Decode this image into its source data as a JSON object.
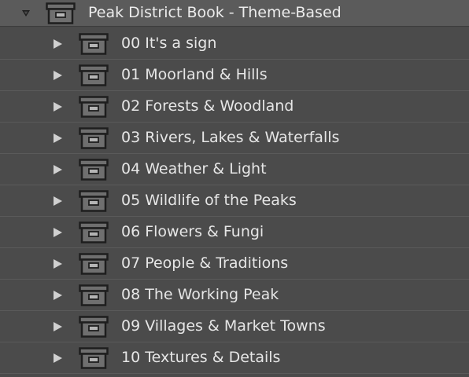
{
  "collection_set": {
    "name": "Peak District Book - Theme-Based",
    "expanded": true,
    "icon": "collection-set-icon",
    "children": [
      {
        "name": "00 It's a sign",
        "icon": "collection-set-icon",
        "expanded": false
      },
      {
        "name": "01 Moorland & Hills",
        "icon": "collection-set-icon",
        "expanded": false
      },
      {
        "name": "02 Forests & Woodland",
        "icon": "collection-set-icon",
        "expanded": false
      },
      {
        "name": "03 Rivers, Lakes & Waterfalls",
        "icon": "collection-set-icon",
        "expanded": false
      },
      {
        "name": "04 Weather & Light",
        "icon": "collection-set-icon",
        "expanded": false
      },
      {
        "name": "05 Wildlife of the Peaks",
        "icon": "collection-set-icon",
        "expanded": false
      },
      {
        "name": "06 Flowers & Fungi",
        "icon": "collection-set-icon",
        "expanded": false
      },
      {
        "name": "07 People & Traditions",
        "icon": "collection-set-icon",
        "expanded": false
      },
      {
        "name": "08 The Working Peak",
        "icon": "collection-set-icon",
        "expanded": false
      },
      {
        "name": "09 Villages & Market Towns",
        "icon": "collection-set-icon",
        "expanded": false
      },
      {
        "name": "10 Textures & Details",
        "icon": "collection-set-icon",
        "expanded": false
      }
    ]
  },
  "colors": {
    "panel_background": "#4a4a4a",
    "parent_row_background": "#5b5b5b",
    "row_separator": "#5a5a5a",
    "text": "#e6e6e6",
    "icon_stroke": "#1e1e1e",
    "icon_fill": "#6f6f6f",
    "disclosure": "#d0d0d0"
  }
}
